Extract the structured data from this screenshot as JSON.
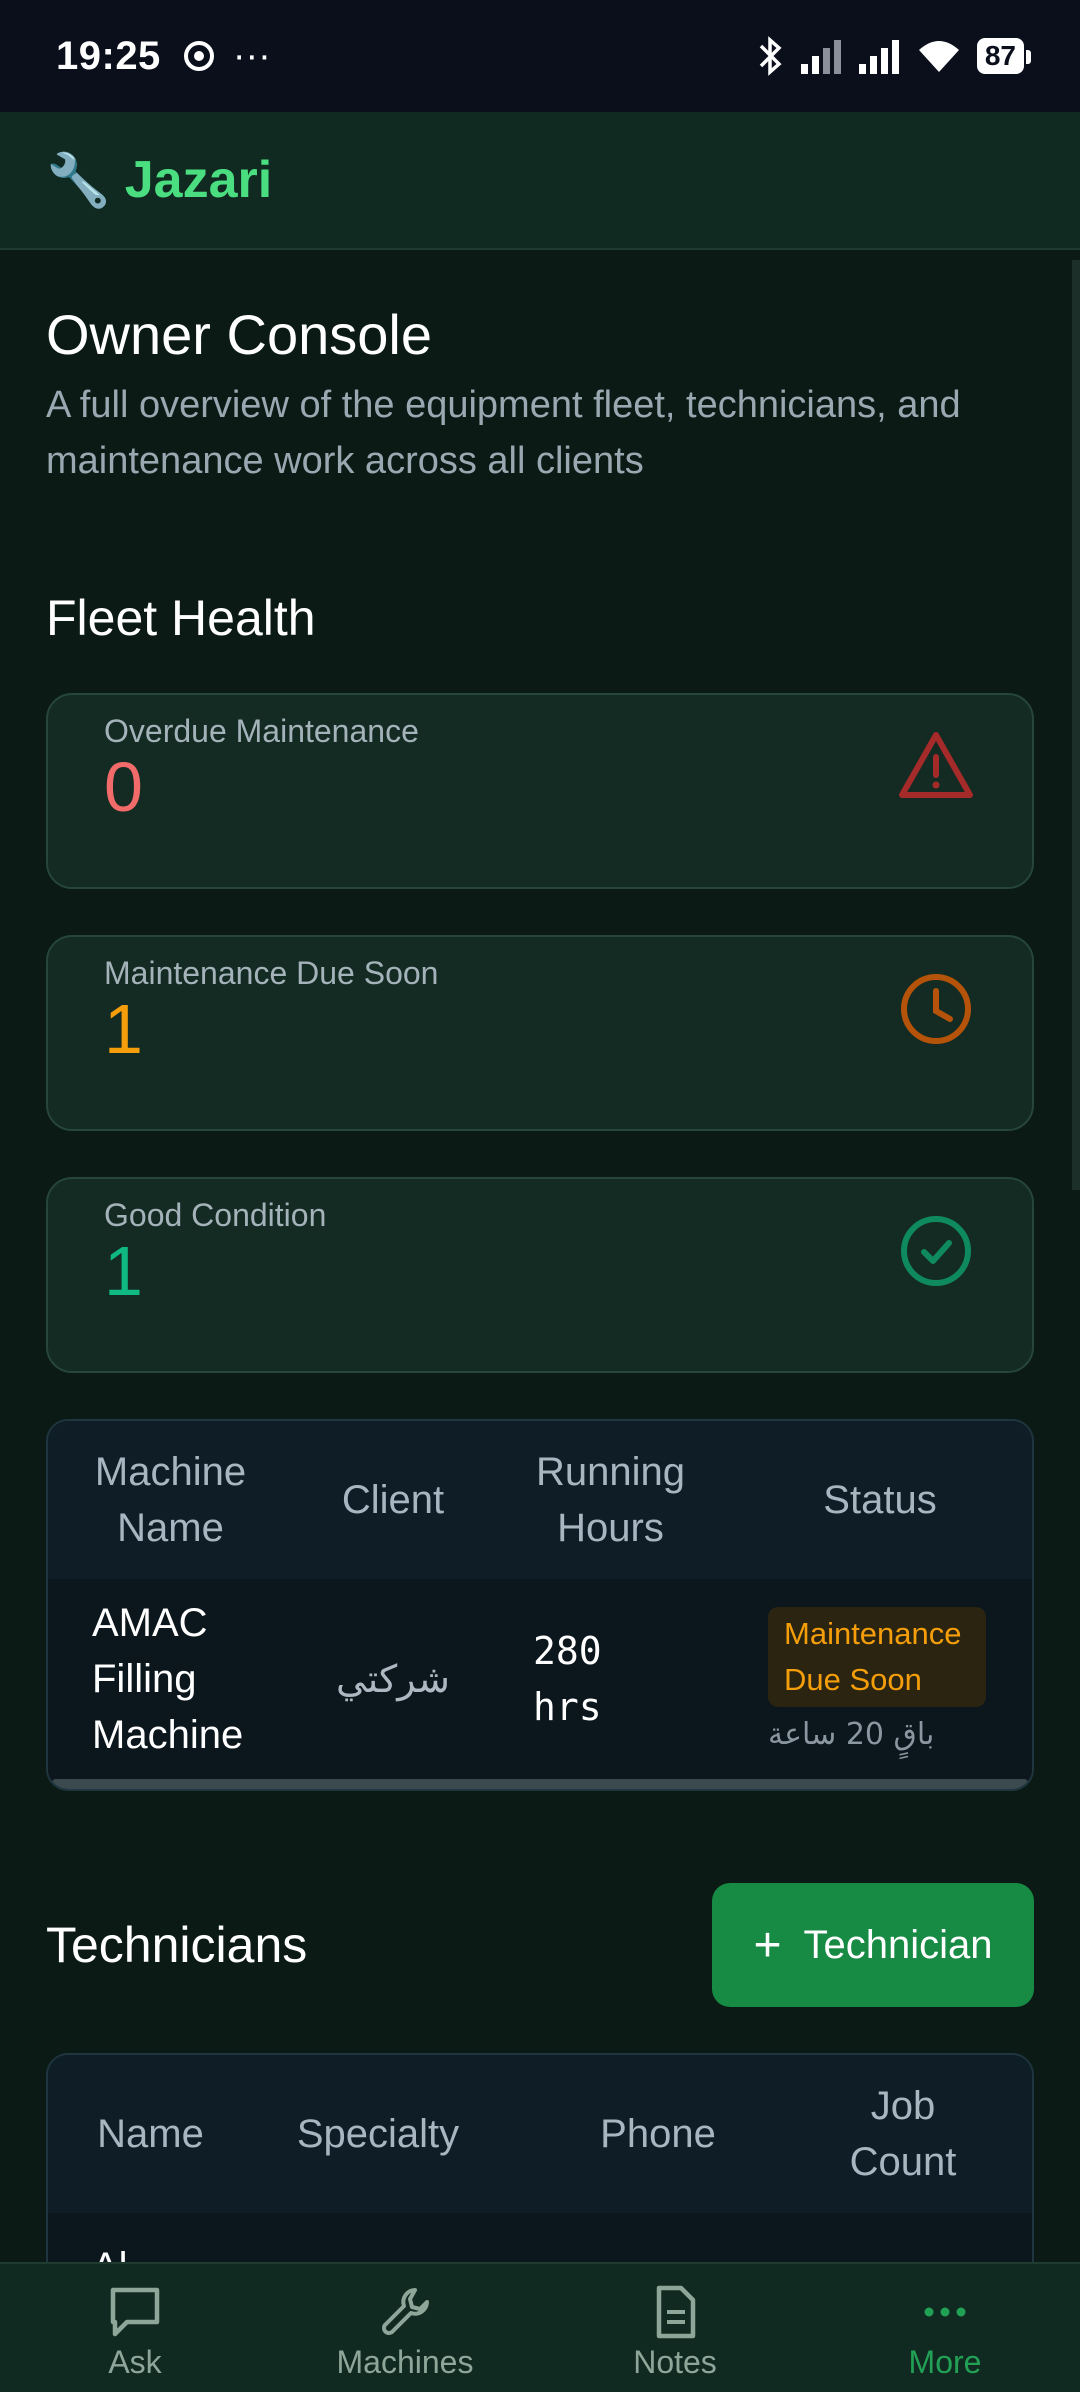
{
  "status_bar": {
    "time": "19:25",
    "battery": "87",
    "dots": "···"
  },
  "app": {
    "brand": "Jazari",
    "brand_icon": "🔧"
  },
  "page": {
    "title": "Owner Console",
    "subtitle": "A full overview of the equipment fleet, technicians, and maintenance work across all clients"
  },
  "fleet": {
    "title": "Fleet Health",
    "kpis": [
      {
        "label": "Overdue Maintenance",
        "value": "0",
        "color": "#f26b6b",
        "icon": "warning-icon"
      },
      {
        "label": "Maintenance Due Soon",
        "value": "1",
        "color": "#f59e0b",
        "icon": "clock-icon"
      },
      {
        "label": "Good Condition",
        "value": "1",
        "color": "#10b981",
        "icon": "check-circle-icon"
      }
    ],
    "table": {
      "headers": [
        "Machine Name",
        "Client",
        "Running Hours",
        "Status"
      ],
      "rows": [
        {
          "machine": "AMAC Filling Machine",
          "client": "شركتي",
          "hours": "280 hrs",
          "status": "Maintenance Due Soon",
          "status_note": "باقٍ 20 ساعة"
        }
      ]
    }
  },
  "technicians": {
    "title": "Technicians",
    "add_button": "Technician",
    "headers": [
      "Name",
      "Specialty",
      "Phone",
      "Job Count"
    ],
    "partial_row_text": "Al"
  },
  "nav": {
    "items": [
      {
        "label": "Ask",
        "icon": "chat-icon"
      },
      {
        "label": "Machines",
        "icon": "wrench-icon"
      },
      {
        "label": "Notes",
        "icon": "document-icon"
      },
      {
        "label": "More",
        "icon": "more-dots-icon"
      }
    ]
  }
}
